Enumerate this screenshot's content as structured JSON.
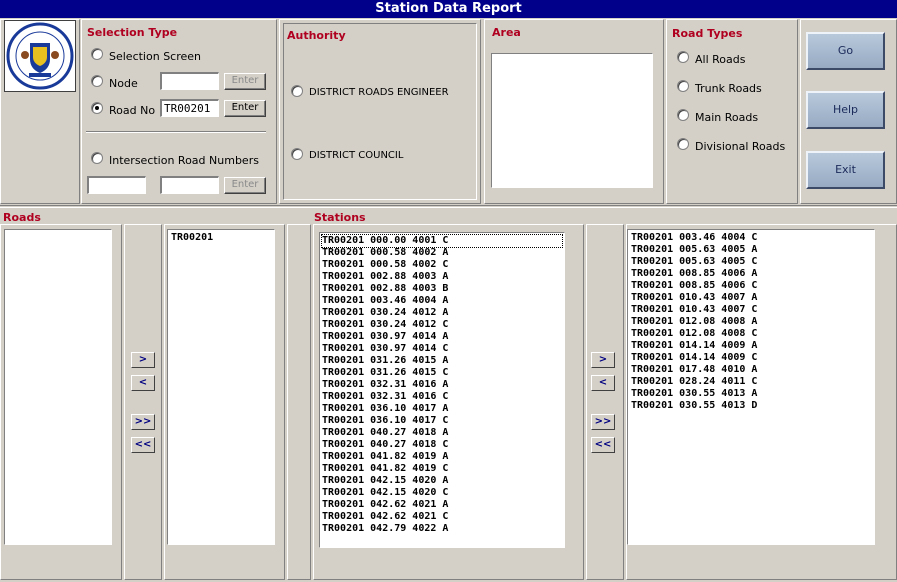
{
  "window": {
    "title": "Station Data Report"
  },
  "selection_type": {
    "heading": "Selection Type",
    "options": [
      {
        "label": "Selection Screen",
        "checked": false
      },
      {
        "label": "Node",
        "checked": false
      },
      {
        "label": "Road No",
        "checked": true
      },
      {
        "label": "Intersection Road Numbers",
        "checked": false
      }
    ],
    "node_value": "",
    "road_no_value": "TR00201",
    "intersection_value_1": "",
    "intersection_value_2": "",
    "enter_label": "Enter"
  },
  "authority": {
    "heading": "Authority",
    "options": [
      "DISTRICT ROADS ENGINEER",
      "DISTRICT COUNCIL"
    ]
  },
  "area": {
    "heading": "Area"
  },
  "road_types": {
    "heading": "Road Types",
    "options": [
      "All Roads",
      "Trunk Roads",
      "Main Roads",
      "Divisional Roads"
    ]
  },
  "actions": {
    "go": "Go",
    "help": "Help",
    "exit": "Exit"
  },
  "roads": {
    "heading": "Roads",
    "available": [],
    "selected": [
      "TR00201"
    ]
  },
  "stations": {
    "heading": "Stations",
    "available": [
      "TR00201 000.00 4001 C",
      "TR00201 000.58 4002 A",
      "TR00201 000.58 4002 C",
      "TR00201 002.88 4003 A",
      "TR00201 002.88 4003 B",
      "TR00201 003.46 4004 A",
      "TR00201 030.24 4012 A",
      "TR00201 030.24 4012 C",
      "TR00201 030.97 4014 A",
      "TR00201 030.97 4014 C",
      "TR00201 031.26 4015 A",
      "TR00201 031.26 4015 C",
      "TR00201 032.31 4016 A",
      "TR00201 032.31 4016 C",
      "TR00201 036.10 4017 A",
      "TR00201 036.10 4017 C",
      "TR00201 040.27 4018 A",
      "TR00201 040.27 4018 C",
      "TR00201 041.82 4019 A",
      "TR00201 041.82 4019 C",
      "TR00201 042.15 4020 A",
      "TR00201 042.15 4020 C",
      "TR00201 042.62 4021 A",
      "TR00201 042.62 4021 C",
      "TR00201 042.79 4022 A"
    ],
    "selected": [
      "TR00201 003.46 4004 C",
      "TR00201 005.63 4005 A",
      "TR00201 005.63 4005 C",
      "TR00201 008.85 4006 A",
      "TR00201 008.85 4006 C",
      "TR00201 010.43 4007 A",
      "TR00201 010.43 4007 C",
      "TR00201 012.08 4008 A",
      "TR00201 012.08 4008 C",
      "TR00201 014.14 4009 A",
      "TR00201 014.14 4009 C",
      "TR00201 017.48 4010 A",
      "TR00201 028.24 4011 C",
      "TR00201 030.55 4013 A",
      "TR00201 030.55 4013 D"
    ]
  },
  "transfer_buttons": {
    "add": ">",
    "remove": "<",
    "add_all": ">>",
    "remove_all": "<<"
  }
}
